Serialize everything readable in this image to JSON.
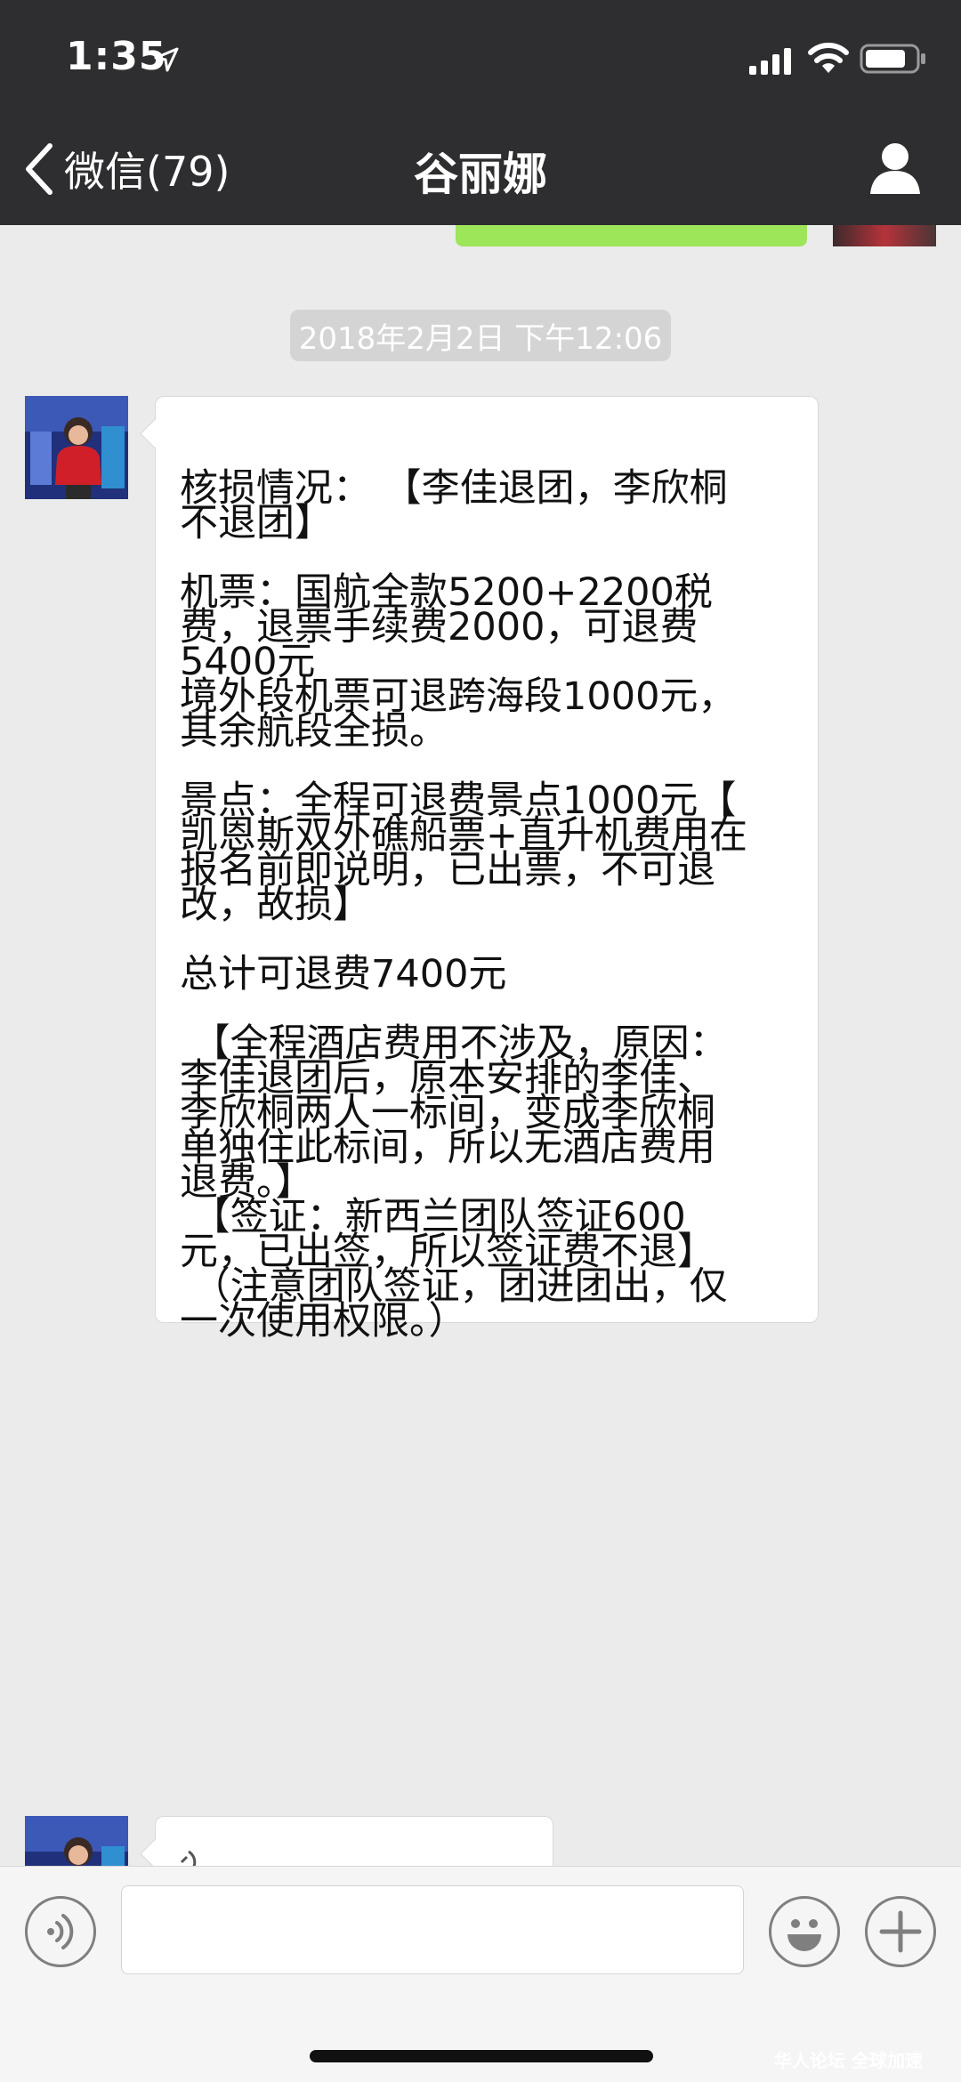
{
  "status_bar": {
    "time": "1:35"
  },
  "header": {
    "back_label": "微信(79)",
    "title": "谷丽娜"
  },
  "chat": {
    "timestamp": "2018年2月2日 下午12:06",
    "messages": [
      {
        "sender": "contact",
        "text": "核损情况： 【李佳退团，李欣桐\n不退团】\n\n机票：国航全款5200+2200税\n费，退票手续费2000，可退费\n5400元\n境外段机票可退跨海段1000元，\n其余航段全损。\n\n景点：全程可退费景点1000元【\n凯恩斯双外礁船票+直升机费用在\n报名前即说明，已出票，不可退\n改，故损】\n\n总计可退费7400元\n\n 【全程酒店费用不涉及，原因：\n李佳退团后，原本安排的李佳、\n李欣桐两人一标间，变成李欣桐\n单独住此标间，所以无酒店费用\n退费。】\n 【签证：新西兰团队签证600\n元，已出签，所以签证费不退】\n （注意团队签证，团进团出，仅\n一次使用权限。）"
      }
    ]
  },
  "input_bar": {
    "placeholder": ""
  },
  "watermark": "华人论坛 全球加速",
  "colors": {
    "header_bg": "#2e2e30",
    "chat_bg": "#ebebeb",
    "sent_bubble": "#9de559",
    "received_bubble": "#ffffff"
  }
}
